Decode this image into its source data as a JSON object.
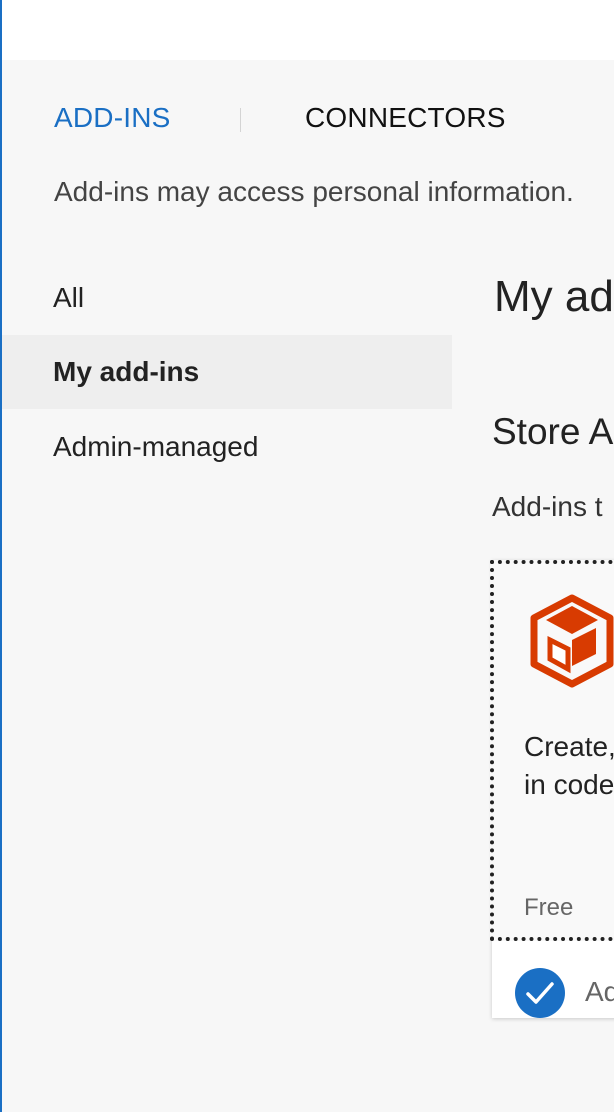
{
  "tabs": [
    {
      "label": "ADD-INS",
      "active": true
    },
    {
      "label": "CONNECTORS",
      "active": false
    }
  ],
  "notice": "Add-ins may access personal information.",
  "sidebar": {
    "items": [
      {
        "label": "All",
        "selected": false
      },
      {
        "label": "My add-ins",
        "selected": true
      },
      {
        "label": "Admin-managed",
        "selected": false
      }
    ]
  },
  "main": {
    "title": "My ad",
    "section_title": "Store A",
    "section_desc": "Add-ins t"
  },
  "card": {
    "logo_icon": "office-store-box-icon",
    "desc_line1": "Create,",
    "desc_line2": "in code",
    "price": "Free",
    "added_label": "Ad",
    "added_icon": "checkmark-icon"
  },
  "colors": {
    "accent": "#1a6fc4",
    "logo": "#d83b01"
  }
}
